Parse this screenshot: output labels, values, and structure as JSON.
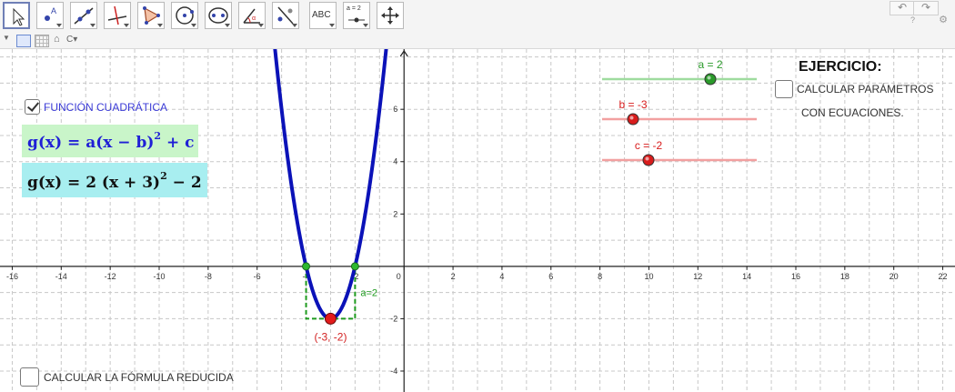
{
  "toolbar": {
    "tools": [
      {
        "name": "move-tool",
        "label": ""
      },
      {
        "name": "point-tool",
        "label": ""
      },
      {
        "name": "line-tool",
        "label": ""
      },
      {
        "name": "perpendicular-tool",
        "label": ""
      },
      {
        "name": "polygon-tool",
        "label": ""
      },
      {
        "name": "circle-center-tool",
        "label": ""
      },
      {
        "name": "ellipse-tool",
        "label": ""
      },
      {
        "name": "angle-tool",
        "label": ""
      },
      {
        "name": "reflect-tool",
        "label": ""
      },
      {
        "name": "text-tool",
        "label": "ABC"
      },
      {
        "name": "slider-tool",
        "label": "a = 2"
      },
      {
        "name": "move-graphics-tool",
        "label": ""
      }
    ],
    "undo": "↶",
    "redo": "↷",
    "help": "?",
    "settings": "⚙"
  },
  "stylebar": {
    "home": "⌂",
    "view": "C▾"
  },
  "checkbox_funcion": {
    "checked": true,
    "label": "FUNCIÓN CUADRÁTICA"
  },
  "formula_general": {
    "lhs": "g(x) = a(x − b)",
    "exp": "2",
    "rhs": " + c",
    "bg": "#c9f5c9",
    "color": "#1f1fd6"
  },
  "formula_specific": {
    "lhs": "g(x) = 2  (x + 3)",
    "exp": "2",
    "rhs": " − 2",
    "bg": "#a8eef0",
    "color": "#111111"
  },
  "ejercicio": {
    "title": "EJERCICIO:",
    "checkbox_label_1": "CALCULAR PARÁMETROS",
    "checkbox_label_2": "CON ECUACIONES."
  },
  "checkbox_reducida": {
    "checked": false,
    "label": "CALCULAR LA FÓRMULA REDUCIDA"
  },
  "sliders": [
    {
      "name": "a",
      "label": "a = 2",
      "value": 2,
      "min": -5,
      "max": 5,
      "color": "#2a9a2a",
      "line": "#9fdc9f"
    },
    {
      "name": "b",
      "label": "b = -3",
      "value": -3,
      "min": -5,
      "max": 5,
      "color": "#d81c1c",
      "line": "#f2a0a0"
    },
    {
      "name": "c",
      "label": "c = -2",
      "value": -2,
      "min": -5,
      "max": 5,
      "color": "#d81c1c",
      "line": "#f2a0a0"
    }
  ],
  "graph": {
    "x_ticks": [
      -16,
      -14,
      -12,
      -10,
      -8,
      -6,
      -4,
      -2,
      0,
      2,
      4,
      6,
      8,
      10,
      12,
      14,
      16,
      18,
      20,
      22
    ],
    "y_ticks": [
      -4,
      -2,
      2,
      4,
      6
    ],
    "xlim": [
      -16.5,
      22.5
    ],
    "ylim": [
      -4.8,
      8.3
    ],
    "function": {
      "a": 2,
      "b": -3,
      "c": -2,
      "color": "#0b12b8"
    },
    "vertex_label": "(-3, -2)",
    "root_left": -4,
    "root_right": -2,
    "a_label": "a=2",
    "colors": {
      "grid": "#c8c8c8",
      "axis": "#222222",
      "vertex": "#e31b1b",
      "roots": "#2fb82f",
      "dashed": "#1e9a1e",
      "vertex_text": "#d32222"
    }
  }
}
